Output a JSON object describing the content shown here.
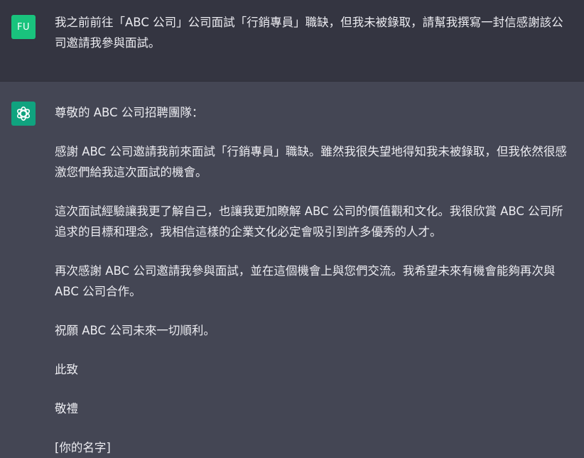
{
  "user_message": {
    "avatar_initials": "FU",
    "text": "我之前前往「ABC 公司」公司面試「行銷專員」職缺，但我未被錄取，請幫我撰寫一封信感謝該公司邀請我參與面試。"
  },
  "assistant_message": {
    "avatar_icon": "openai-logo-icon",
    "paragraphs": [
      "尊敬的 ABC 公司招聘團隊：",
      "感謝 ABC 公司邀請我前來面試「行銷專員」職缺。雖然我很失望地得知我未被錄取，但我依然很感激您們給我這次面試的機會。",
      "這次面試經驗讓我更了解自己，也讓我更加瞭解 ABC 公司的價值觀和文化。我很欣賞 ABC 公司所追求的目標和理念，我相信這樣的企業文化必定會吸引到許多優秀的人才。",
      "再次感謝 ABC 公司邀請我參與面試，並在這個機會上與您們交流。我希望未來有機會能夠再次與 ABC 公司合作。",
      "祝願 ABC 公司未來一切順利。",
      "此致",
      "敬禮",
      "[你的名字]"
    ]
  },
  "colors": {
    "user_background": "#343541",
    "assistant_background": "#444654",
    "text": "#ececf1",
    "user_avatar": "#19c37d",
    "assistant_avatar": "#10a37f"
  }
}
